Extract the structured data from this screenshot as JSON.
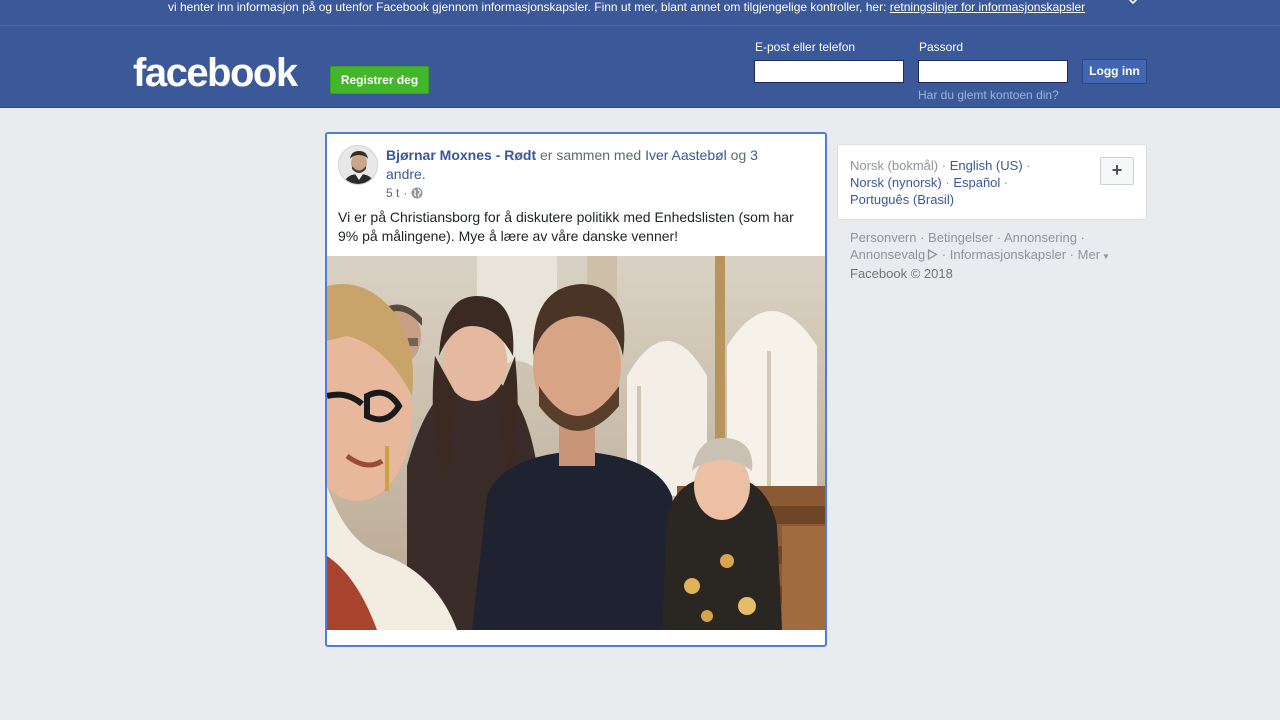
{
  "cookie_banner": {
    "text": "vi henter inn informasjon på og utenfor Facebook gjennom informasjonskapsler. Finn ut mer, blant annet om tilgjengelige kontroller, her:",
    "link": "retningslinjer for informasjonskapsler",
    "close_icon": "close-icon"
  },
  "header": {
    "logo": "facebook",
    "register_label": "Registrer deg",
    "email_label": "E-post eller telefon",
    "password_label": "Passord",
    "login_label": "Logg inn",
    "forgot_link": "Har du glemt kontoen din?"
  },
  "post": {
    "author": "Bjørnar Moxnes - Rødt",
    "with_text": "er sammen med",
    "tagged_person": "Iver Aastebøl",
    "and_text": "og",
    "others_link": "3 andre.",
    "time": "5 t",
    "separator": "·",
    "privacy_icon": "globe-icon",
    "body": "Vi er på Christiansborg for å diskutere politikk med Enhedslisten (som har 9% på målingene). Mye å lære av våre danske venner!"
  },
  "languages": {
    "current": "Norsk (bokmål)",
    "items": [
      "English (US)",
      "Norsk (nynorsk)",
      "Español",
      "Português (Brasil)"
    ],
    "add_label": "+"
  },
  "footer": {
    "links": [
      "Personvern",
      "Betingelser",
      "Annonsering",
      "Annonsevalg",
      "Informasjonskapsler",
      "Mer"
    ],
    "copyright": "Facebook © 2018"
  },
  "colors": {
    "brand_blue": "#3b5998",
    "register_green": "#42b72a",
    "link_blue": "#385898",
    "page_bg": "#e9ebee"
  }
}
